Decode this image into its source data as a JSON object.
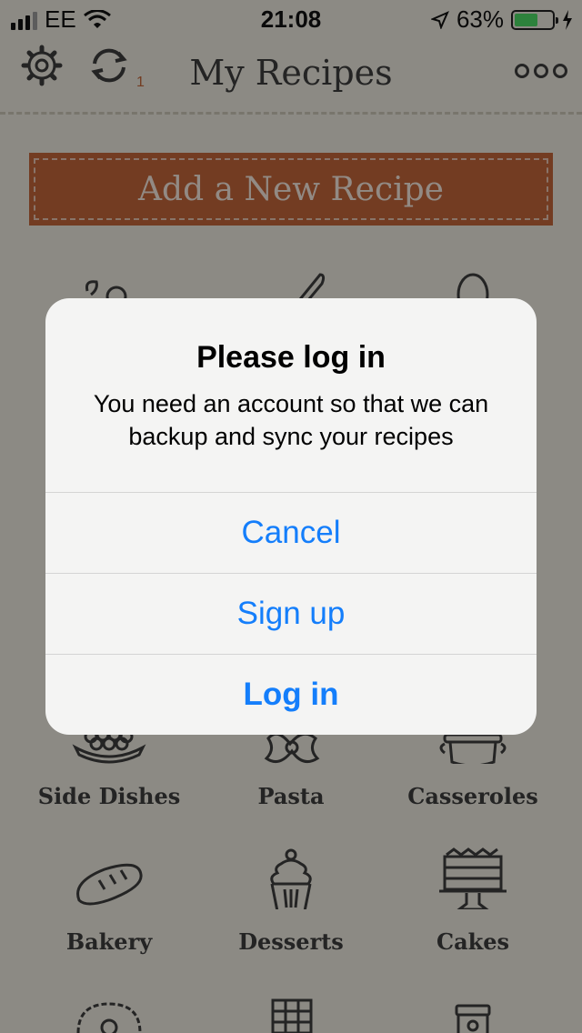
{
  "status_bar": {
    "carrier": "EE",
    "time": "21:08",
    "battery_percent": "63%",
    "battery_level": 0.63
  },
  "nav_bar": {
    "title": "My Recipes",
    "sync_badge": "1"
  },
  "add_recipe_label": "Add a New Recipe",
  "categories": [
    {
      "label": "Side Dishes",
      "icon": "side-dishes-icon"
    },
    {
      "label": "Pasta",
      "icon": "pasta-icon"
    },
    {
      "label": "Casseroles",
      "icon": "casserole-icon"
    },
    {
      "label": "Bakery",
      "icon": "bread-icon"
    },
    {
      "label": "Desserts",
      "icon": "cupcake-icon"
    },
    {
      "label": "Cakes",
      "icon": "cake-icon"
    }
  ],
  "alert": {
    "title": "Please log in",
    "message": "You need an account so that we can backup and sync your recipes",
    "buttons": {
      "cancel": "Cancel",
      "sign_up": "Sign up",
      "log_in": "Log in"
    }
  },
  "colors": {
    "accent": "#147efb",
    "brand": "#c0653a",
    "background": "#e9e6dc"
  }
}
